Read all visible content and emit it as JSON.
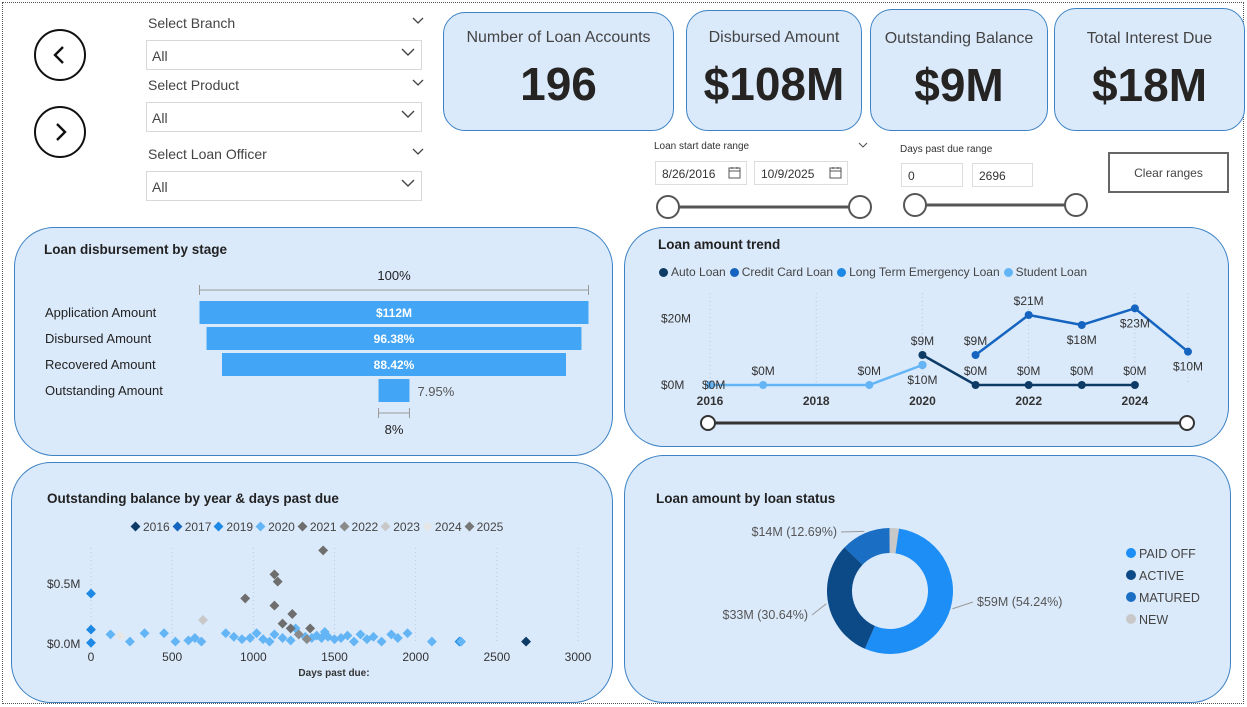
{
  "nav": {
    "back_icon": "chevron-left-icon",
    "forward_icon": "chevron-right-icon"
  },
  "slicers": [
    {
      "label": "Select Branch",
      "value": "All"
    },
    {
      "label": "Select Product",
      "value": "All"
    },
    {
      "label": "Select Loan Officer",
      "value": "All"
    }
  ],
  "kpis": [
    {
      "title": "Number of Loan Accounts",
      "value": "196"
    },
    {
      "title": "Disbursed Amount",
      "value": "$108M"
    },
    {
      "title": "Outstanding Balance",
      "value": "$9M"
    },
    {
      "title": "Total Interest Due",
      "value": "$18M"
    }
  ],
  "date_range": {
    "label": "Loan start date range",
    "start": "8/26/2016",
    "end": "10/9/2025",
    "start_fraction": 0.0,
    "end_fraction": 1.0
  },
  "dpd_range": {
    "label": "Days past due range",
    "min": "0",
    "max": "2696",
    "min_fraction": 0.0,
    "max_fraction": 1.0
  },
  "clear_button": "Clear ranges",
  "funnel": {
    "title": "Loan disbursement by stage",
    "top_pct": "100%",
    "bottom_pct": "8%",
    "stages": [
      {
        "label": "Application Amount",
        "value_label": "$112M",
        "pct": 100
      },
      {
        "label": "Disbursed Amount",
        "value_label": "96.38%",
        "pct": 96.38
      },
      {
        "label": "Recovered Amount",
        "value_label": "88.42%",
        "pct": 88.42
      },
      {
        "label": "Outstanding Amount",
        "value_label": "7.95%",
        "pct": 7.95
      }
    ],
    "color": "#42a5f5"
  },
  "trend": {
    "title": "Loan amount trend",
    "legend": [
      {
        "name": "Auto Loan",
        "color": "#0d3b66"
      },
      {
        "name": "Credit Card Loan",
        "color": "#1565c0"
      },
      {
        "name": "Long Term Emergency Loan",
        "color": "#1e88e5"
      },
      {
        "name": "Student Loan",
        "color": "#64b5f6"
      }
    ],
    "y_ticks": [
      "$20M",
      "$0M"
    ],
    "x_ticks": [
      "2016",
      "2018",
      "2020",
      "2022",
      "2024"
    ],
    "slider": {
      "start_fraction": 0.0,
      "end_fraction": 1.0
    }
  },
  "chart_data": [
    {
      "type": "line",
      "title": "Loan amount trend",
      "x": [
        2016,
        2017,
        2018,
        2019,
        2020,
        2021,
        2022,
        2023,
        2024,
        2025
      ],
      "ylim": [
        0,
        30
      ],
      "series": [
        {
          "name": "Auto Loan",
          "color": "#0d3b66",
          "values": [
            null,
            null,
            null,
            null,
            9,
            0,
            0,
            0,
            0,
            null
          ],
          "labels": [
            "",
            "",
            "",
            "",
            "$9M",
            "$0M",
            "$0M",
            "$0M",
            "$0M",
            ""
          ],
          "label_pos": [
            "",
            "",
            "",
            "",
            "above",
            "above",
            "above",
            "above",
            "above",
            ""
          ]
        },
        {
          "name": "Credit Card Loan",
          "color": "#1565c0",
          "values": [
            null,
            null,
            null,
            null,
            null,
            9,
            21,
            18,
            23,
            10
          ],
          "labels": [
            "",
            "",
            "",
            "",
            "",
            "$9M",
            "$21M",
            "$18M",
            "$23M",
            "$10M"
          ],
          "label_pos": [
            "",
            "",
            "",
            "",
            "",
            "above",
            "above",
            "below",
            "below",
            "below"
          ]
        },
        {
          "name": "Long Term Emergency Loan",
          "color": "#1e88e5",
          "values": [
            null,
            null,
            null,
            null,
            6,
            null,
            null,
            null,
            null,
            null
          ],
          "labels": [
            "",
            "",
            "",
            "",
            "$10M",
            "",
            "",
            "",
            "",
            ""
          ],
          "label_pos": [
            "",
            "",
            "",
            "",
            "below",
            "",
            "",
            "",
            "",
            ""
          ]
        },
        {
          "name": "Student Loan",
          "color": "#64b5f6",
          "values": [
            0,
            0,
            null,
            0,
            6,
            null,
            null,
            null,
            null,
            null
          ],
          "labels": [
            "$0M",
            "$0M",
            "",
            "$0M",
            "",
            "",
            "",
            "",
            "",
            ""
          ],
          "label_pos": [
            "right",
            "above",
            "",
            "above",
            "",
            "",
            "",
            "",
            "",
            ""
          ]
        }
      ]
    },
    {
      "type": "scatter",
      "title": "Outstanding balance by year & days past due",
      "xlabel": "Days past due:",
      "xlim": [
        0,
        3000
      ],
      "ylim": [
        0,
        0.8
      ],
      "x_ticks": [
        "0",
        "500",
        "1000",
        "1500",
        "2000",
        "2500",
        "3000"
      ],
      "y_ticks": [
        "$0.5M",
        "$0.0M"
      ],
      "series": [
        {
          "name": "2016",
          "color": "#0d3b66",
          "points": [
            [
              2680,
              0.02
            ]
          ]
        },
        {
          "name": "2017",
          "color": "#1565c0",
          "points": []
        },
        {
          "name": "2019",
          "color": "#1e88e5",
          "points": [
            [
              0,
              0.42
            ],
            [
              0,
              0.12
            ],
            [
              0,
              0.01
            ],
            [
              2270,
              0.02
            ]
          ]
        },
        {
          "name": "2020",
          "color": "#64b5f6",
          "points": [
            [
              120,
              0.08
            ],
            [
              240,
              0.02
            ],
            [
              330,
              0.09
            ],
            [
              450,
              0.09
            ],
            [
              520,
              0.02
            ],
            [
              600,
              0.03
            ],
            [
              640,
              0.05
            ],
            [
              680,
              0.02
            ],
            [
              830,
              0.09
            ],
            [
              880,
              0.06
            ],
            [
              930,
              0.04
            ],
            [
              980,
              0.05
            ],
            [
              1020,
              0.09
            ],
            [
              1060,
              0.04
            ],
            [
              1100,
              0.02
            ],
            [
              1130,
              0.08
            ],
            [
              1180,
              0.05
            ],
            [
              1230,
              0.03
            ],
            [
              1280,
              0.08
            ],
            [
              1320,
              0.06
            ],
            [
              1360,
              0.05
            ],
            [
              1390,
              0.07
            ],
            [
              1420,
              0.05
            ],
            [
              1460,
              0.06
            ],
            [
              1500,
              0.04
            ],
            [
              1540,
              0.05
            ],
            [
              1580,
              0.07
            ],
            [
              1620,
              0.02
            ],
            [
              1660,
              0.08
            ],
            [
              1700,
              0.04
            ],
            [
              1740,
              0.06
            ],
            [
              1790,
              0.02
            ],
            [
              1850,
              0.08
            ],
            [
              1890,
              0.05
            ],
            [
              1950,
              0.09
            ],
            [
              2100,
              0.02
            ],
            [
              2280,
              0.02
            ],
            [
              1440,
              0.1
            ],
            [
              1260,
              0.13
            ]
          ]
        },
        {
          "name": "2021",
          "color": "#6e6e6e",
          "points": [
            [
              1430,
              0.78
            ],
            [
              1130,
              0.58
            ],
            [
              1150,
              0.52
            ],
            [
              950,
              0.38
            ],
            [
              1130,
              0.32
            ],
            [
              1240,
              0.25
            ],
            [
              1180,
              0.17
            ],
            [
              1230,
              0.13
            ],
            [
              1350,
              0.13
            ]
          ]
        },
        {
          "name": "2022",
          "color": "#8a8a8a",
          "points": [
            [
              1280,
              0.08
            ],
            [
              1330,
              0.04
            ]
          ]
        },
        {
          "name": "2023",
          "color": "#c8c8c8",
          "points": [
            [
              690,
              0.2
            ]
          ]
        },
        {
          "name": "2024",
          "color": "#e6e6e6",
          "points": [
            [
              180,
              0.07
            ]
          ]
        },
        {
          "name": "2025",
          "color": "#777777",
          "points": []
        }
      ]
    },
    {
      "type": "pie",
      "title": "Loan amount by loan status",
      "slices": [
        {
          "name": "PAID OFF",
          "value": 59,
          "pct": 54.24,
          "label": "$59M (54.24%)",
          "color": "#1c8ef5"
        },
        {
          "name": "ACTIVE",
          "value": 33,
          "pct": 30.64,
          "label": "$33M (30.64%)",
          "color": "#0c4a87"
        },
        {
          "name": "MATURED",
          "value": 14,
          "pct": 12.69,
          "label": "$14M (12.69%)",
          "color": "#1a6fc4"
        },
        {
          "name": "NEW",
          "value": 2.6,
          "pct": 2.43,
          "label": "",
          "color": "#c8c8c8"
        }
      ]
    }
  ],
  "scatter_meta": {
    "title": "Outstanding balance by year & days past due",
    "xlabel": "Days past due:",
    "legend": [
      {
        "name": "2016",
        "color": "#0d3b66"
      },
      {
        "name": "2017",
        "color": "#1565c0"
      },
      {
        "name": "2019",
        "color": "#1e88e5"
      },
      {
        "name": "2020",
        "color": "#64b5f6"
      },
      {
        "name": "2021",
        "color": "#6e6e6e"
      },
      {
        "name": "2022",
        "color": "#8a8a8a"
      },
      {
        "name": "2023",
        "color": "#c8c8c8"
      },
      {
        "name": "2024",
        "color": "#e6e6e6"
      },
      {
        "name": "2025",
        "color": "#777777"
      }
    ]
  },
  "donut_meta": {
    "title": "Loan amount by loan status",
    "legend": [
      {
        "name": "PAID OFF",
        "color": "#1c8ef5"
      },
      {
        "name": "ACTIVE",
        "color": "#0c4a87"
      },
      {
        "name": "MATURED",
        "color": "#1a6fc4"
      },
      {
        "name": "NEW",
        "color": "#c8c8c8"
      }
    ]
  }
}
